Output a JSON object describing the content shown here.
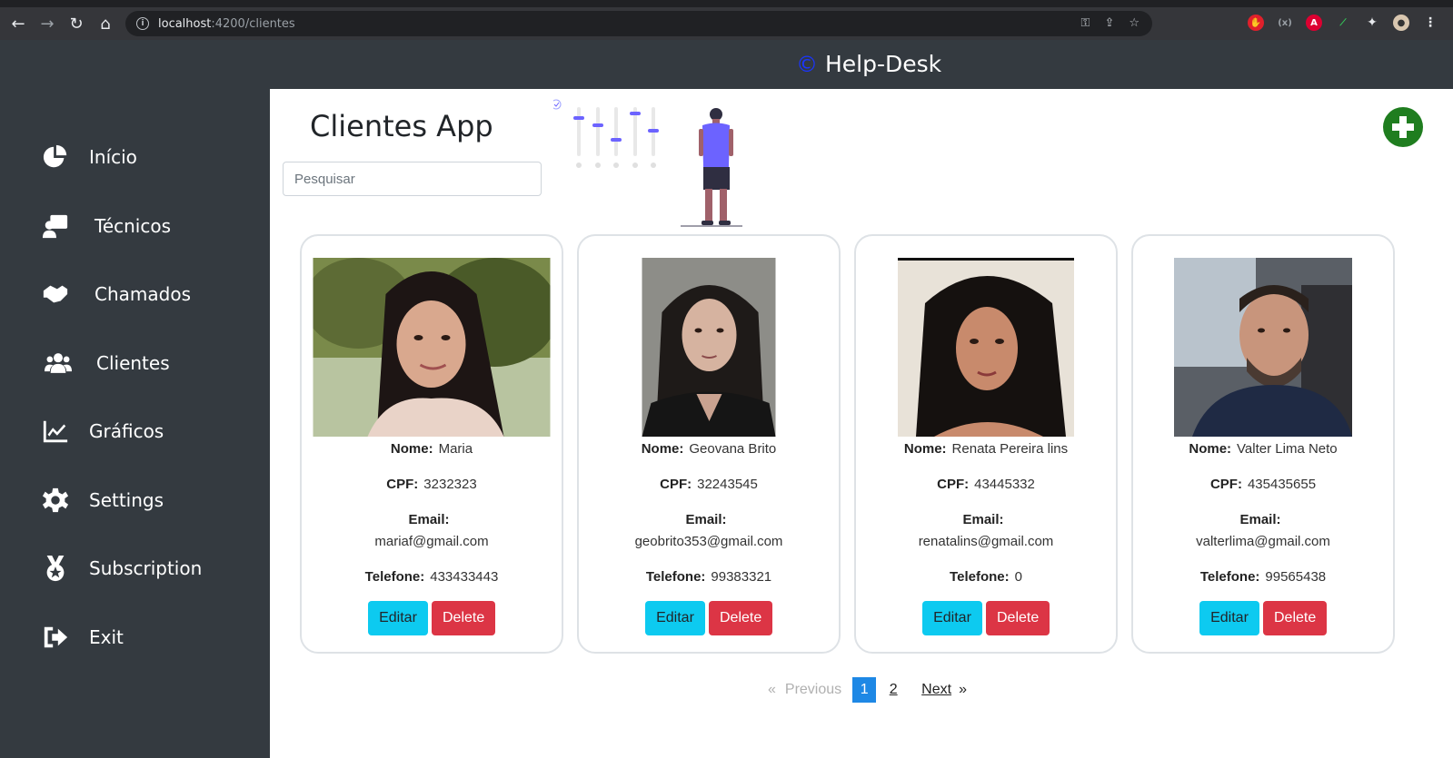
{
  "browser": {
    "url_host": "localhost",
    "url_path": ":4200/clientes"
  },
  "header": {
    "brand_symbol": "©",
    "brand": "Help-Desk"
  },
  "sidebar": {
    "items": [
      {
        "label": "Início",
        "icon": "pie-chart-icon"
      },
      {
        "label": "Técnicos",
        "icon": "technician-icon"
      },
      {
        "label": "Chamados",
        "icon": "handshake-icon"
      },
      {
        "label": "Clientes",
        "icon": "users-icon"
      },
      {
        "label": "Gráficos",
        "icon": "chart-line-icon"
      },
      {
        "label": "Settings",
        "icon": "gear-icon"
      },
      {
        "label": "Subscription",
        "icon": "medal-icon"
      },
      {
        "label": "Exit",
        "icon": "sign-out-icon"
      }
    ]
  },
  "main": {
    "title": "Clientes App",
    "search_placeholder": "Pesquisar",
    "labels": {
      "nome": "Nome:",
      "cpf": "CPF:",
      "email": "Email:",
      "telefone": "Telefone:",
      "edit": "Editar",
      "delete": "Delete"
    },
    "clients": [
      {
        "nome": "Maria",
        "cpf": "3232323",
        "email": "mariaf@gmail.com",
        "telefone": "433433443"
      },
      {
        "nome": "Geovana Brito",
        "cpf": "32243545",
        "email": "geobrito353@gmail.com",
        "telefone": "99383321"
      },
      {
        "nome": "Renata Pereira lins",
        "cpf": "43445332",
        "email": "renatalins@gmail.com",
        "telefone": "0"
      },
      {
        "nome": "Valter Lima Neto",
        "cpf": "435435655",
        "email": "valterlima@gmail.com",
        "telefone": "99565438"
      }
    ]
  },
  "pagination": {
    "prev_arrow": "«",
    "prev": "Previous",
    "pages": [
      "1",
      "2"
    ],
    "next": "Next",
    "next_arrow": "»"
  },
  "colors": {
    "sidebar_bg": "#343a40",
    "edit_button": "#0dcaf0",
    "delete_button": "#dc3545",
    "add_button": "#1f7d1f",
    "active_page": "#1e88e5"
  }
}
